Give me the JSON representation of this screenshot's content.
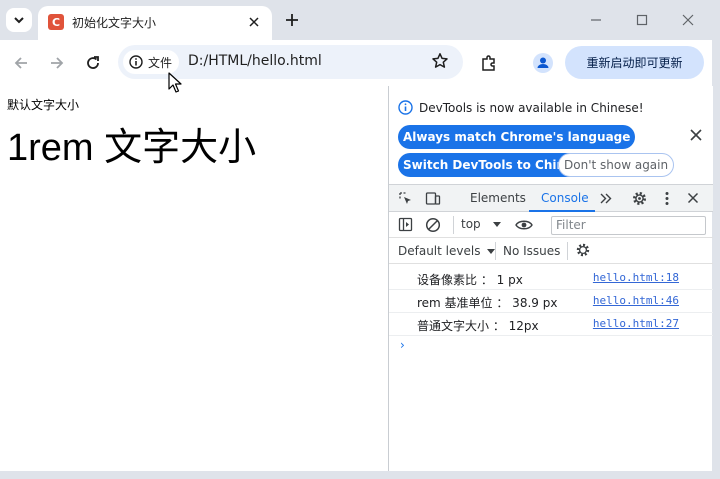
{
  "browser": {
    "tab": {
      "favicon_letter": "C",
      "title": "初始化文字大小"
    },
    "address": {
      "chip_label": "文件",
      "url": "D:/HTML/hello.html"
    },
    "relaunch_label": "重新启动即可更新"
  },
  "page": {
    "default_text": "默认文字大小",
    "rem_text": "1rem 文字大小"
  },
  "devtools": {
    "notice": {
      "text": "DevTools is now available in Chinese!",
      "always_match": "Always match Chrome's language",
      "switch": "Switch DevTools to Chinese",
      "dont_show": "Don't show again"
    },
    "tabs": {
      "elements": "Elements",
      "console": "Console"
    },
    "console": {
      "context": "top",
      "filter_placeholder": "Filter",
      "default_levels": "Default levels",
      "issues": "No Issues",
      "logs": [
        {
          "message": "设备像素比 ： 1 px",
          "source": "hello.html:18"
        },
        {
          "message": "rem 基准单位 ： 38.9 px",
          "source": "hello.html:46"
        },
        {
          "message": "普通文字大小 ： 12px",
          "source": "hello.html:27"
        }
      ],
      "prompt": "›"
    }
  },
  "colors": {
    "accent": "#1a73e8",
    "relaunch_bg": "#d3e3fd",
    "favicon": "#e0533a"
  }
}
